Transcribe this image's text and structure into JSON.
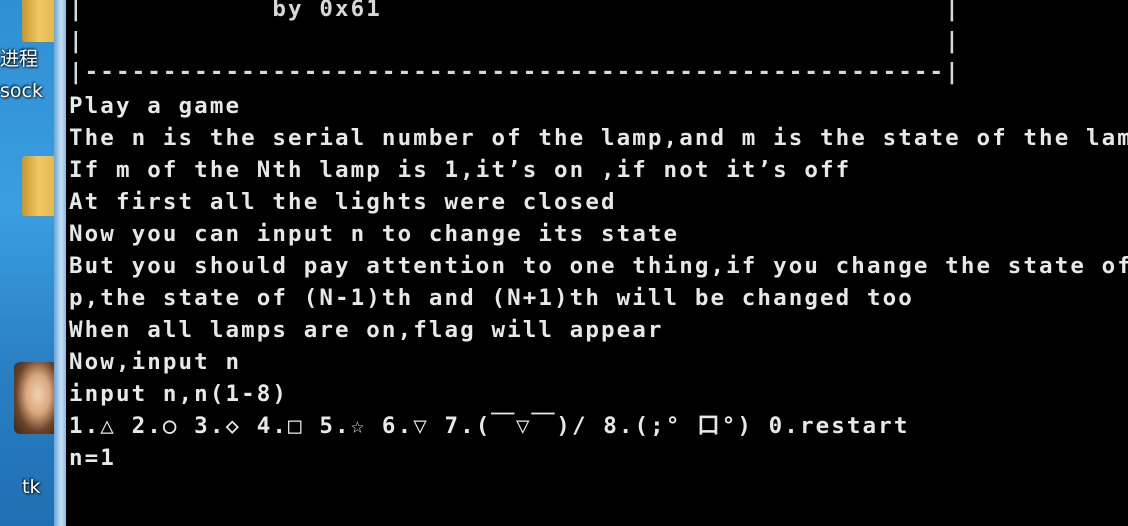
{
  "desktop": {
    "icon_label_1": "进程",
    "icon_label_2": "sock",
    "icon_label_3": "tk"
  },
  "console": {
    "banner": [
      "|            by 0x61                                    |",
      "|                                                       |",
      "|-------------------------------------------------------|"
    ],
    "lines": [
      "Play a game",
      "The n is the serial number of the lamp,and m is the state of the lamp",
      "If m of the Nth lamp is 1,it’s on ,if not it’s off",
      "At first all the lights were closed",
      "Now you can input n to change its state",
      "But you should pay attention to one thing,if you change the state of",
      "p,the state of (N-1)th and (N+1)th will be changed too",
      "When all lamps are on,flag will appear",
      "Now,input n",
      "input n,n(1-8)",
      "1.△ 2.○ 3.◇ 4.□ 5.☆ 6.▽ 7.(￣▽￣)/ 8.(;° 口°) 0.restart",
      "n=1"
    ]
  }
}
